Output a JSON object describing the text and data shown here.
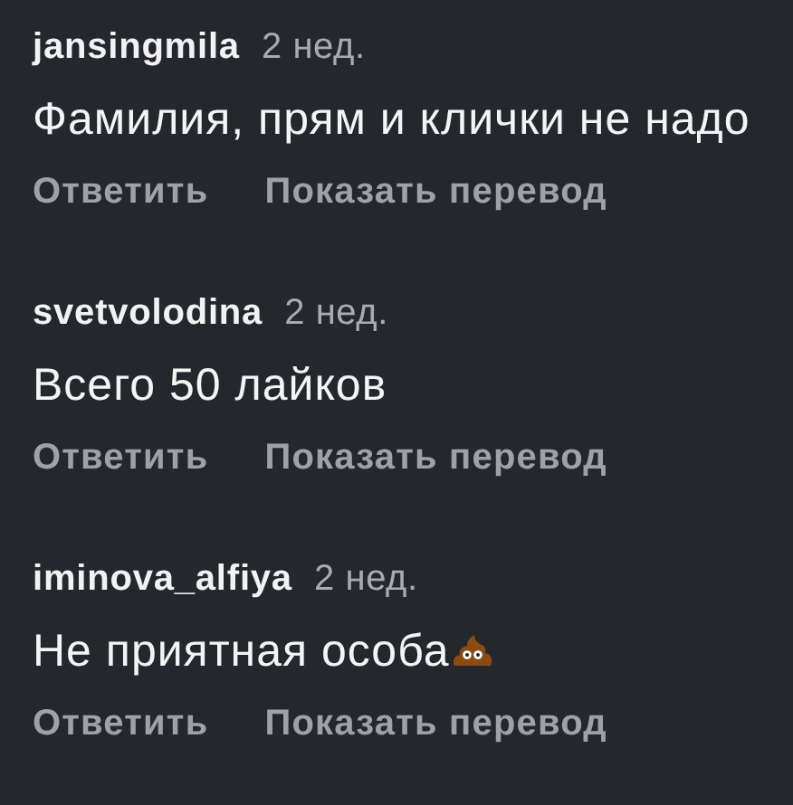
{
  "comments": [
    {
      "username": "jansingmila",
      "time": "2 нед.",
      "text": "Фамилия, прям и клички не надо",
      "trailing_icon": false,
      "actions": [
        "Ответить",
        "Показать перевод"
      ]
    },
    {
      "username": "svetvolodina",
      "time": "2 нед.",
      "text": "Всего 50 лайков",
      "trailing_icon": false,
      "actions": [
        "Ответить",
        "Показать перевод"
      ]
    },
    {
      "username": "iminova_alfiya",
      "time": "2 нед.",
      "text": "Не приятная особа",
      "trailing_icon": true,
      "actions": [
        "Ответить",
        "Показать перевод"
      ]
    }
  ]
}
